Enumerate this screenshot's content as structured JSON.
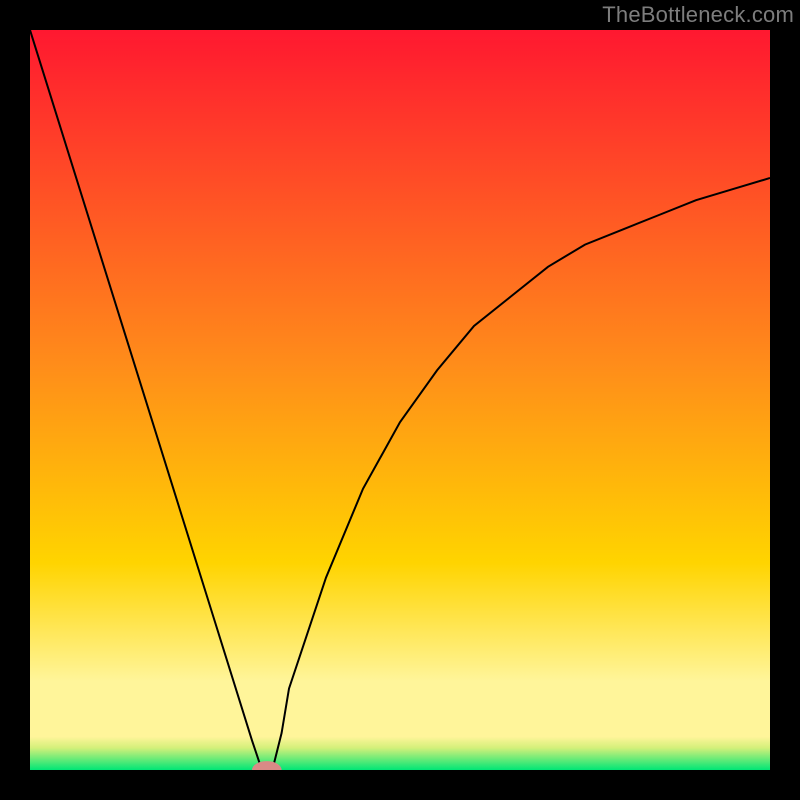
{
  "watermark": "TheBottleneck.com",
  "chart_data": {
    "type": "line",
    "title": "",
    "xlabel": "",
    "ylabel": "",
    "xlim": [
      0,
      100
    ],
    "ylim": [
      0,
      100
    ],
    "grid": false,
    "legend": false,
    "background_gradient": {
      "top_color": "#ff1830",
      "mid_color": "#ffd400",
      "bottom_band_color": "#fff59a",
      "bottom_edge_color": "#00e676"
    },
    "x": [
      0,
      5,
      10,
      15,
      20,
      25,
      30,
      31,
      32,
      33,
      34,
      35,
      40,
      45,
      50,
      55,
      60,
      65,
      70,
      75,
      80,
      85,
      90,
      95,
      100
    ],
    "values": [
      100,
      84,
      68,
      52,
      36,
      20,
      4,
      1,
      0,
      1,
      5,
      11,
      26,
      38,
      47,
      54,
      60,
      64,
      68,
      71,
      73,
      75,
      77,
      78.5,
      80
    ],
    "marker": {
      "x": 32,
      "y": 0,
      "color": "#d98a86",
      "rx": 2.0,
      "ry": 1.2
    },
    "series_color": "#000000",
    "series_width": 2
  }
}
